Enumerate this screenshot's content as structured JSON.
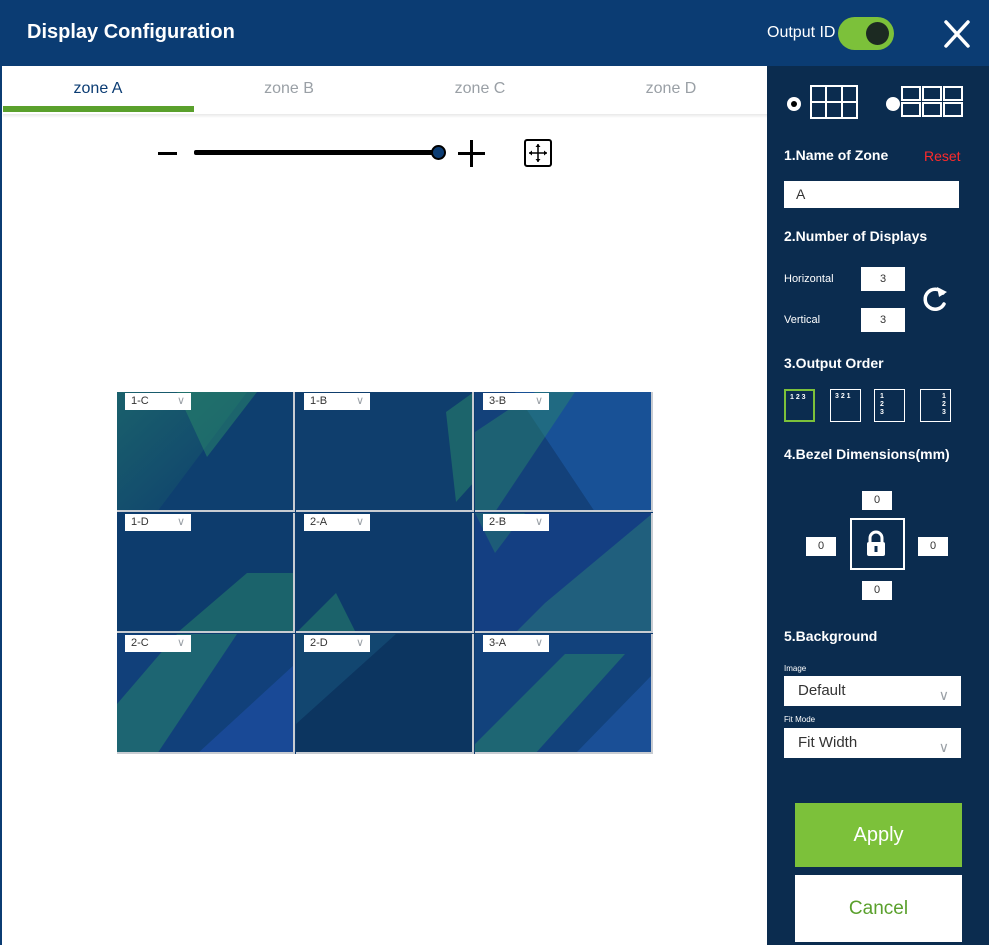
{
  "header": {
    "title": "Display Configuration",
    "output_id_label": "Output ID",
    "output_id_on": true,
    "close_icon": "close-x-icon"
  },
  "tabs": [
    {
      "label": "zone A",
      "active": true
    },
    {
      "label": "zone B",
      "active": false
    },
    {
      "label": "zone C",
      "active": false
    },
    {
      "label": "zone D",
      "active": false
    }
  ],
  "zoom": {
    "minus_icon": "minus-icon",
    "plus_icon": "plus-icon",
    "fit_icon": "fit-to-screen-icon",
    "level": 1.0
  },
  "wall": {
    "columns": 3,
    "rows": 3,
    "cells": [
      {
        "label": "1-C"
      },
      {
        "label": "1-B"
      },
      {
        "label": "3-B"
      },
      {
        "label": "1-D"
      },
      {
        "label": "2-A"
      },
      {
        "label": "2-B"
      },
      {
        "label": "2-C"
      },
      {
        "label": "2-D"
      },
      {
        "label": "3-A"
      }
    ]
  },
  "panel": {
    "layout_options": [
      {
        "icon": "grid-3x2-icon",
        "selected": true
      },
      {
        "icon": "grid-3x2-small-icon",
        "selected": false
      }
    ],
    "name_of_zone": {
      "title": "1.Name of Zone",
      "reset_label": "Reset",
      "value": "A"
    },
    "number_of_displays": {
      "title": "2.Number of Displays",
      "horizontal_label": "Horizontal",
      "horizontal_value": "3",
      "vertical_label": "Vertical",
      "vertical_value": "3",
      "refresh_icon": "refresh-icon"
    },
    "output_order": {
      "title": "3.Output Order",
      "options": [
        {
          "text": "1 2 3",
          "active": true
        },
        {
          "text": "3 2 1",
          "active": false
        },
        {
          "text": "1\n2\n3",
          "active": false
        },
        {
          "text": "1\n2\n3",
          "active": false
        }
      ]
    },
    "bezel": {
      "title": "4.Bezel Dimensions(mm)",
      "top": "0",
      "left": "0",
      "right": "0",
      "bottom": "0",
      "lock_icon": "lock-icon"
    },
    "background": {
      "title": "5.Background",
      "image_label": "Image",
      "image_value": "Default",
      "fit_mode_label": "Fit Mode",
      "fit_mode_value": "Fit Width"
    },
    "apply_label": "Apply",
    "cancel_label": "Cancel"
  },
  "colors": {
    "header_bg": "#0b3c73",
    "panel_bg": "#0b2c4f",
    "accent_green": "#7cc13a",
    "reset_red": "#ff2a2a"
  }
}
